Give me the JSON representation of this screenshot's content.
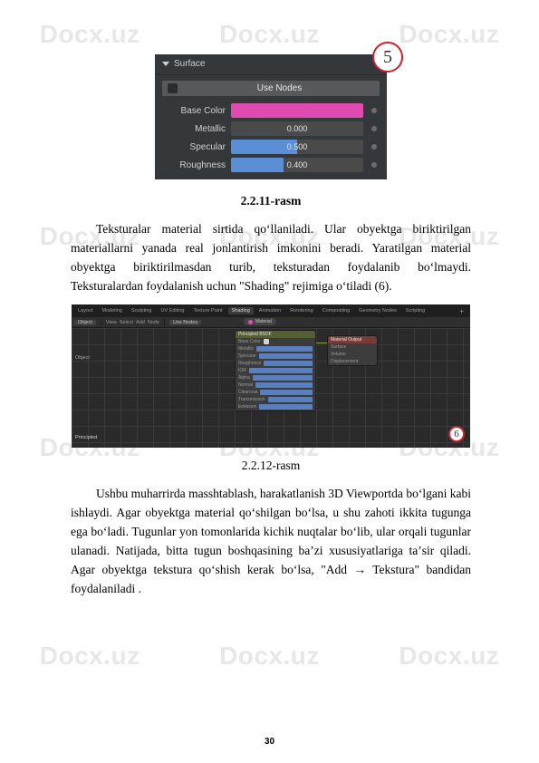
{
  "watermark": "Docx.uz",
  "figure1": {
    "panel_title": "Surface",
    "use_nodes_label": "Use Nodes",
    "badge": "5",
    "props": {
      "base_color": {
        "label": "Base Color",
        "value_hex": "#e04bb0"
      },
      "metallic": {
        "label": "Metallic",
        "value": "0.000",
        "fill_pct": 0
      },
      "specular": {
        "label": "Specular",
        "value": "0.500",
        "fill_pct": 50
      },
      "roughness": {
        "label": "Roughness",
        "value": "0.400",
        "fill_pct": 40
      }
    }
  },
  "caption1": "2.2.11-rasm",
  "para1": "Teksturalar material sirtida qoʻllaniladi. Ular obyektga biriktirilgan materiallarni yanada real jonlantirish imkonini beradi. Yaratilgan material obyektga biriktirilmasdan turib, teksturadan foydalanib boʻlmaydi. Teksturalardan foydalanish uchun \"Shading\" rejimiga oʻtiladi (6).",
  "figure2": {
    "tabs": [
      "Layout",
      "Modeling",
      "Sculpting",
      "UV Editing",
      "Texture Paint",
      "Shading",
      "Animation",
      "Rendering",
      "Compositing",
      "Geometry Nodes",
      "Scripting"
    ],
    "active_tab_index": 5,
    "toolbar": {
      "object": "Object",
      "menus": [
        "View",
        "Select",
        "Add",
        "Node"
      ],
      "use_nodes": "Use Nodes"
    },
    "material_pill": "Material",
    "panel_left": "Object",
    "node_main_title": "Principled BSDF",
    "node_main_rows": [
      "Base Color",
      "Metallic",
      "Specular",
      "Roughness",
      "IOR",
      "Alpha",
      "Normal",
      "Clearcoat",
      "Transmission",
      "Emission"
    ],
    "node_out_title": "Material Output",
    "node_out_rows": [
      "Surface",
      "Volume",
      "Displacement"
    ],
    "bottom_label": "Principled",
    "badge": "6"
  },
  "caption2": "2.2.12-rasm",
  "para2": "Ushbu muharrirda masshtablash, harakatlanish 3D Viewportda boʻlgani kabi ishlaydi. Agar obyektga material qoʻshilgan boʻlsa, u shu zahoti ikkita tugunga ega boʻladi. Tugunlar yon tomonlarida kichik nuqtalar boʻlib, ular orqali tugunlar ulanadi. Natijada, bitta tugun boshqasining baʼzi xususiyatlariga taʼsir qiladi. Agar obyektga tekstura qoʻshish kerak boʻlsa, \"Add → Tekstura\" bandidan foydalaniladi .",
  "page_number": "30"
}
